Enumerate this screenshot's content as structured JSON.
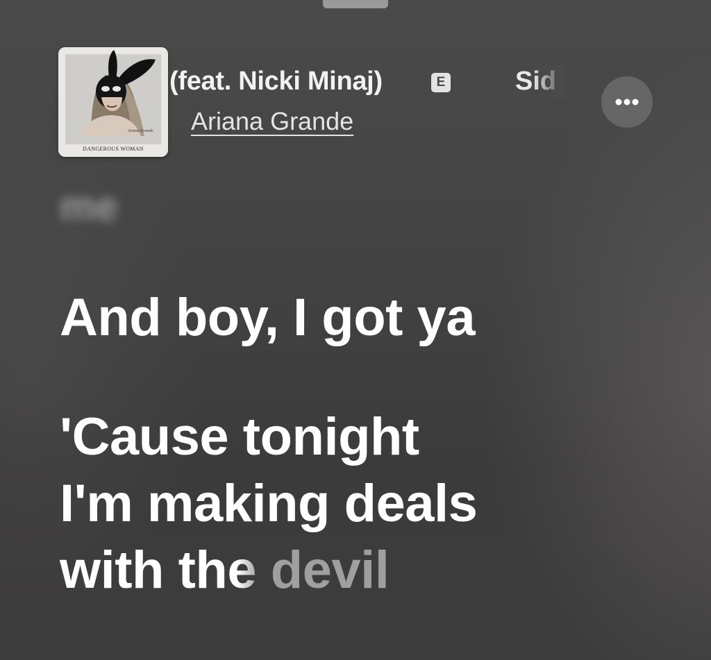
{
  "now_playing": {
    "title": "(feat. Nicki Minaj)",
    "explicit_badge": "E",
    "next_title_peek": "Sid",
    "artist": "Ariana Grande",
    "album_art_caption": "DANGEROUS WOMAN"
  },
  "icons": {
    "more": "ellipsis-icon",
    "explicit": "explicit-icon"
  },
  "lyrics": {
    "previous_line_blurred": "me",
    "lines": [
      {
        "text": "And boy, I got ya"
      },
      {
        "line_a": "'Cause tonight",
        "line_b": "I'm making deals",
        "line_c_sung": "with th",
        "line_c_fading": "e",
        "line_c_unsung": " devil"
      }
    ]
  },
  "colors": {
    "background": "#464646",
    "active_lyric": "#ffffff",
    "unsung_lyric": "#9f9f9f",
    "more_button": "#666666"
  }
}
